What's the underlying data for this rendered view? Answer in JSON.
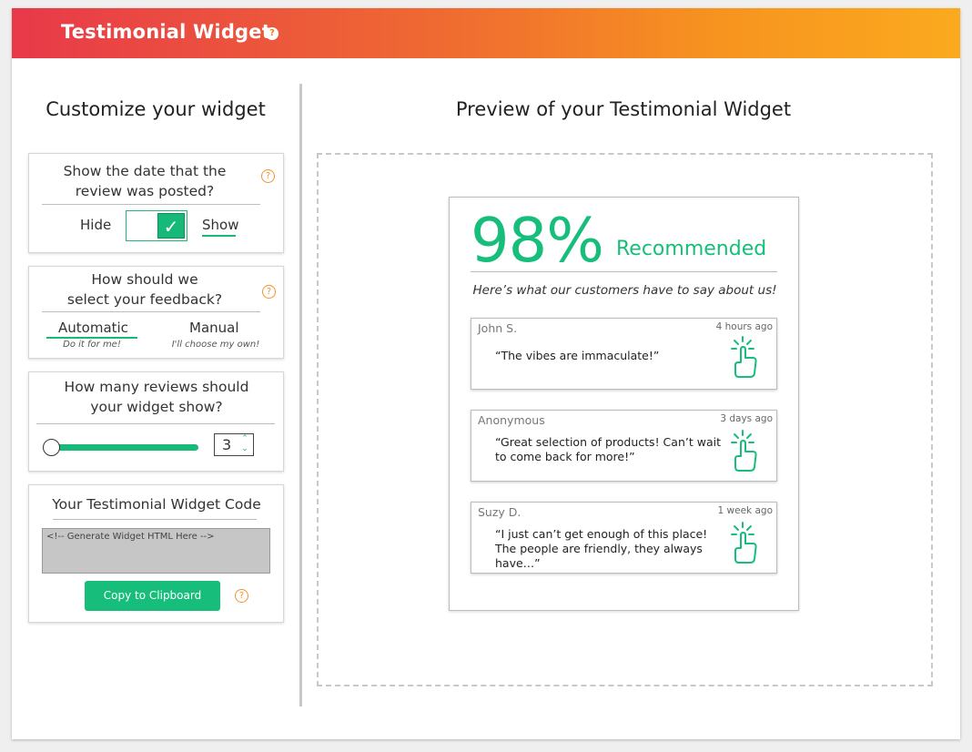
{
  "header": {
    "title": "Testimonial Widget",
    "help_icon": "?"
  },
  "left": {
    "title": "Customize your widget",
    "date_card": {
      "question": "Show the date that the review was posted?",
      "hide_label": "Hide",
      "show_label": "Show",
      "selected": "Show",
      "help": "?"
    },
    "select_card": {
      "question_line1": "How should we",
      "question_line2": "select your feedback?",
      "automatic_label": "Automatic",
      "automatic_sub": "Do it for me!",
      "manual_label": "Manual",
      "manual_sub": "I'll choose my own!",
      "selected": "Automatic",
      "help": "?"
    },
    "count_card": {
      "question": "How many reviews should your widget show?",
      "value": "3",
      "slider_fraction": 0
    },
    "code_card": {
      "title": "Your Testimonial Widget Code",
      "placeholder": "<!-- Generate Widget HTML Here -->",
      "copy_label": "Copy to Clipboard",
      "help": "?"
    }
  },
  "right": {
    "title": "Preview of your Testimonial Widget",
    "widget": {
      "percent": "98%",
      "recommended": "Recommended",
      "tagline": "Here’s what our customers have to say about us!",
      "reviews": [
        {
          "name": "John S.",
          "time": "4 hours ago",
          "text": "“The vibes are immaculate!”"
        },
        {
          "name": "Anonymous",
          "time": "3 days ago",
          "text": "“Great selection of products! Can’t wait to come back for more!”"
        },
        {
          "name": "Suzy D.",
          "time": "1 week ago",
          "text": "“I just can’t get enough of this place! The people are friendly, they always have…”"
        }
      ]
    }
  },
  "colors": {
    "accent_green": "#17be7b",
    "header_start": "#e8394a",
    "header_end": "#fbaa1f",
    "help_orange": "#f5922b"
  }
}
